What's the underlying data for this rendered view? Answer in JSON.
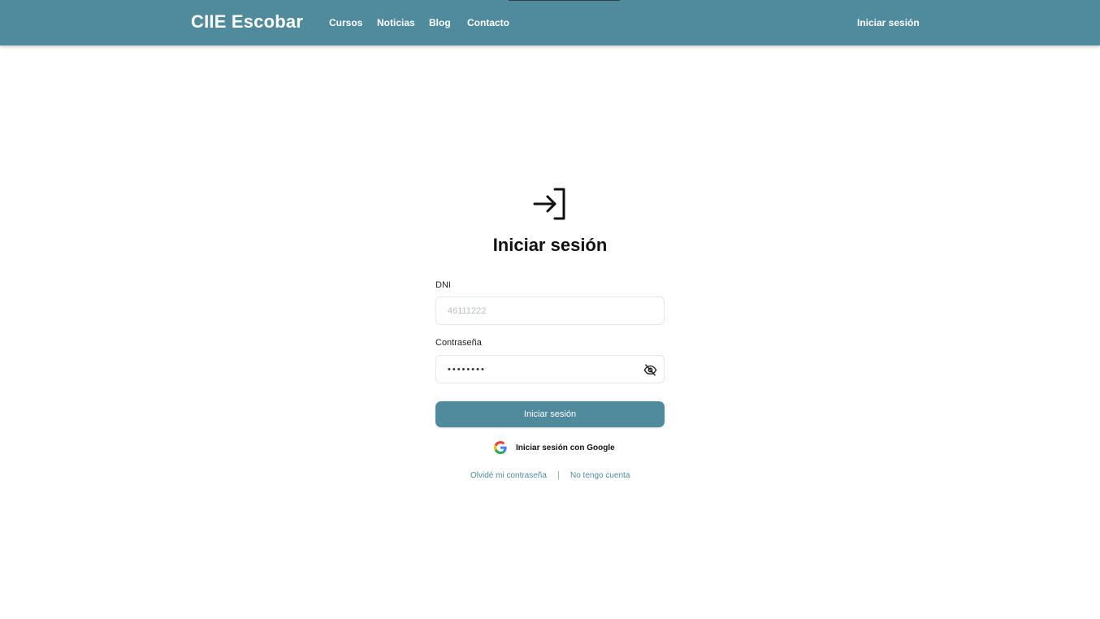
{
  "header": {
    "brand": "CIIE Escobar",
    "nav": [
      "Cursos",
      "Noticias",
      "Blog",
      "Contacto"
    ],
    "login_link": "Iniciar sesión"
  },
  "login": {
    "icon": "login-arrow-icon",
    "title": "Iniciar sesión",
    "dni_label": "DNI",
    "dni_placeholder": "46111222",
    "password_label": "Contraseña",
    "password_value": "12345678",
    "password_toggle_icon": "eye-off-icon",
    "submit_label": "Iniciar sesión",
    "google_label": "Iniciar sesión con Google",
    "forgot_link": "Olvidé mi contraseña",
    "separator": "|",
    "register_link": "No tengo cuenta"
  },
  "colors": {
    "primary": "#4f8a9d",
    "background": "#ffffff",
    "text": "#111111"
  }
}
